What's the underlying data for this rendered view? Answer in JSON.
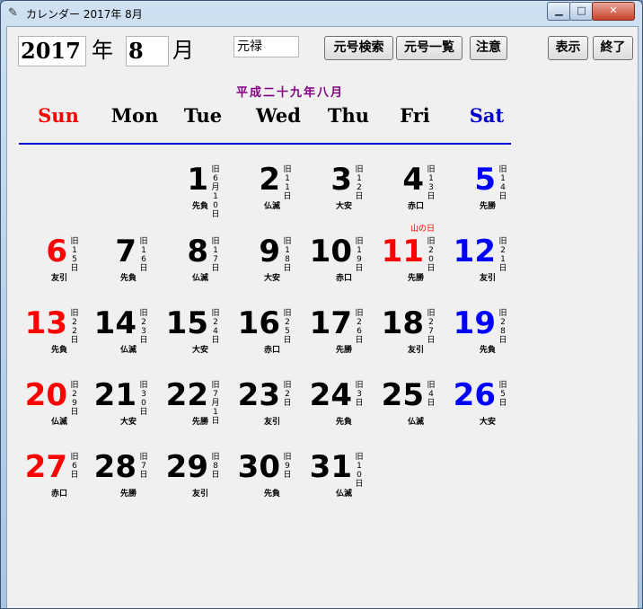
{
  "window": {
    "title": "カレンダー 2017年  8月",
    "buttons": {
      "minimize": "▁",
      "maximize": "□",
      "close": "✕"
    }
  },
  "controls": {
    "year_value": "2017",
    "year_unit": "年",
    "month_value": "8",
    "month_unit": "月",
    "era_name": "元禄",
    "buttons": {
      "era_search": "元号検索",
      "era_list": "元号一覧",
      "notice": "注意",
      "show": "表示",
      "quit": "終了"
    }
  },
  "calendar": {
    "wareki_title": "平成二十九年八月",
    "weekdays": [
      "Sun",
      "Mon",
      "Tue",
      "Wed",
      "Thu",
      "Fri",
      "Sat"
    ],
    "days": [
      {
        "d": "1",
        "col": 2,
        "row": 0,
        "color": "black",
        "old": "旧6月10日",
        "old_green": true,
        "rokuyo": "先負",
        "rokuyo_red": false,
        "holiday": ""
      },
      {
        "d": "2",
        "col": 3,
        "row": 0,
        "color": "black",
        "old": "旧11日",
        "old_green": false,
        "rokuyo": "仏滅",
        "rokuyo_red": false,
        "holiday": ""
      },
      {
        "d": "3",
        "col": 4,
        "row": 0,
        "color": "black",
        "old": "旧12日",
        "old_green": false,
        "rokuyo": "大安",
        "rokuyo_red": true,
        "holiday": ""
      },
      {
        "d": "4",
        "col": 5,
        "row": 0,
        "color": "black",
        "old": "旧13日",
        "old_green": false,
        "rokuyo": "赤口",
        "rokuyo_red": false,
        "holiday": ""
      },
      {
        "d": "5",
        "col": 6,
        "row": 0,
        "color": "blue",
        "old": "旧14日",
        "old_green": false,
        "rokuyo": "先勝",
        "rokuyo_red": false,
        "holiday": ""
      },
      {
        "d": "6",
        "col": 0,
        "row": 1,
        "color": "red",
        "old": "旧15日",
        "old_green": false,
        "rokuyo": "友引",
        "rokuyo_red": false,
        "holiday": ""
      },
      {
        "d": "7",
        "col": 1,
        "row": 1,
        "color": "black",
        "old": "旧16日",
        "old_green": false,
        "rokuyo": "先負",
        "rokuyo_red": false,
        "holiday": ""
      },
      {
        "d": "8",
        "col": 2,
        "row": 1,
        "color": "black",
        "old": "旧17日",
        "old_green": false,
        "rokuyo": "仏滅",
        "rokuyo_red": false,
        "holiday": ""
      },
      {
        "d": "9",
        "col": 3,
        "row": 1,
        "color": "black",
        "old": "旧18日",
        "old_green": false,
        "rokuyo": "大安",
        "rokuyo_red": true,
        "holiday": ""
      },
      {
        "d": "10",
        "col": 4,
        "row": 1,
        "color": "black",
        "old": "旧19日",
        "old_green": false,
        "rokuyo": "赤口",
        "rokuyo_red": false,
        "holiday": ""
      },
      {
        "d": "11",
        "col": 5,
        "row": 1,
        "color": "red",
        "old": "旧20日",
        "old_green": false,
        "rokuyo": "先勝",
        "rokuyo_red": false,
        "holiday": "山の日"
      },
      {
        "d": "12",
        "col": 6,
        "row": 1,
        "color": "blue",
        "old": "旧21日",
        "old_green": false,
        "rokuyo": "友引",
        "rokuyo_red": false,
        "holiday": ""
      },
      {
        "d": "13",
        "col": 0,
        "row": 2,
        "color": "red",
        "old": "旧22日",
        "old_green": false,
        "rokuyo": "先負",
        "rokuyo_red": false,
        "holiday": ""
      },
      {
        "d": "14",
        "col": 1,
        "row": 2,
        "color": "black",
        "old": "旧23日",
        "old_green": false,
        "rokuyo": "仏滅",
        "rokuyo_red": false,
        "holiday": ""
      },
      {
        "d": "15",
        "col": 2,
        "row": 2,
        "color": "black",
        "old": "旧24日",
        "old_green": false,
        "rokuyo": "大安",
        "rokuyo_red": true,
        "holiday": ""
      },
      {
        "d": "16",
        "col": 3,
        "row": 2,
        "color": "black",
        "old": "旧25日",
        "old_green": false,
        "rokuyo": "赤口",
        "rokuyo_red": false,
        "holiday": ""
      },
      {
        "d": "17",
        "col": 4,
        "row": 2,
        "color": "black",
        "old": "旧26日",
        "old_green": false,
        "rokuyo": "先勝",
        "rokuyo_red": false,
        "holiday": ""
      },
      {
        "d": "18",
        "col": 5,
        "row": 2,
        "color": "black",
        "old": "旧27日",
        "old_green": false,
        "rokuyo": "友引",
        "rokuyo_red": false,
        "holiday": ""
      },
      {
        "d": "19",
        "col": 6,
        "row": 2,
        "color": "blue",
        "old": "旧28日",
        "old_green": false,
        "rokuyo": "先負",
        "rokuyo_red": false,
        "holiday": ""
      },
      {
        "d": "20",
        "col": 0,
        "row": 3,
        "color": "red",
        "old": "旧29日",
        "old_green": false,
        "rokuyo": "仏滅",
        "rokuyo_red": false,
        "holiday": ""
      },
      {
        "d": "21",
        "col": 1,
        "row": 3,
        "color": "black",
        "old": "旧30日",
        "old_green": false,
        "rokuyo": "大安",
        "rokuyo_red": true,
        "holiday": ""
      },
      {
        "d": "22",
        "col": 2,
        "row": 3,
        "color": "black",
        "old": "旧7月1日",
        "old_green": true,
        "rokuyo": "先勝",
        "rokuyo_red": false,
        "holiday": ""
      },
      {
        "d": "23",
        "col": 3,
        "row": 3,
        "color": "black",
        "old": "旧2日",
        "old_green": false,
        "rokuyo": "友引",
        "rokuyo_red": false,
        "holiday": ""
      },
      {
        "d": "24",
        "col": 4,
        "row": 3,
        "color": "black",
        "old": "旧3日",
        "old_green": false,
        "rokuyo": "先負",
        "rokuyo_red": false,
        "holiday": ""
      },
      {
        "d": "25",
        "col": 5,
        "row": 3,
        "color": "black",
        "old": "旧4日",
        "old_green": false,
        "rokuyo": "仏滅",
        "rokuyo_red": false,
        "holiday": ""
      },
      {
        "d": "26",
        "col": 6,
        "row": 3,
        "color": "blue",
        "old": "旧5日",
        "old_green": false,
        "rokuyo": "大安",
        "rokuyo_red": true,
        "holiday": ""
      },
      {
        "d": "27",
        "col": 0,
        "row": 4,
        "color": "red",
        "old": "旧6日",
        "old_green": false,
        "rokuyo": "赤口",
        "rokuyo_red": false,
        "holiday": ""
      },
      {
        "d": "28",
        "col": 1,
        "row": 4,
        "color": "black",
        "old": "旧7日",
        "old_green": false,
        "rokuyo": "先勝",
        "rokuyo_red": false,
        "holiday": ""
      },
      {
        "d": "29",
        "col": 2,
        "row": 4,
        "color": "black",
        "old": "旧8日",
        "old_green": false,
        "rokuyo": "友引",
        "rokuyo_red": false,
        "holiday": ""
      },
      {
        "d": "30",
        "col": 3,
        "row": 4,
        "color": "black",
        "old": "旧9日",
        "old_green": false,
        "rokuyo": "先負",
        "rokuyo_red": false,
        "holiday": ""
      },
      {
        "d": "31",
        "col": 4,
        "row": 4,
        "color": "black",
        "old": "旧10日",
        "old_green": false,
        "rokuyo": "仏滅",
        "rokuyo_red": false,
        "holiday": ""
      }
    ]
  }
}
